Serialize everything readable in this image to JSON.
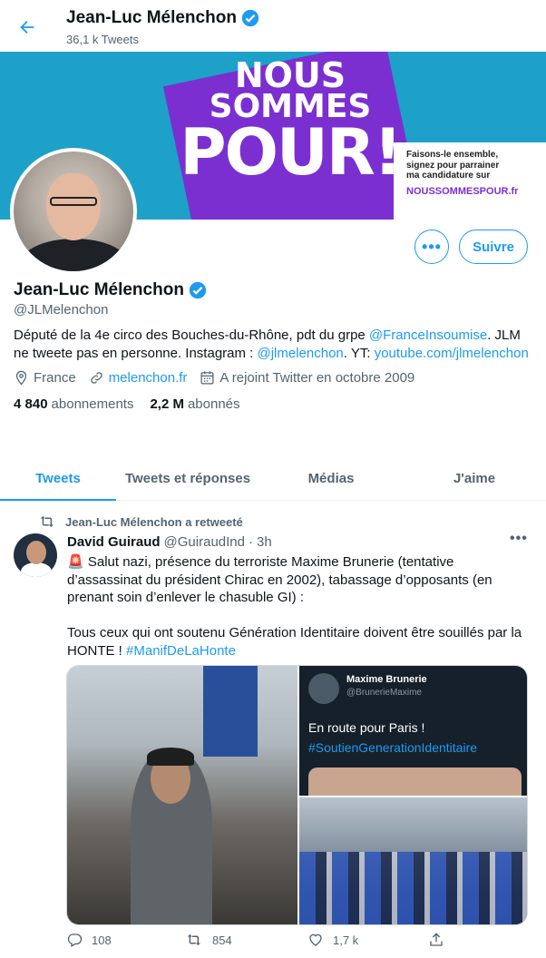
{
  "header": {
    "name": "Jean-Luc Mélenchon",
    "tweet_count": "36,1 k Tweets"
  },
  "banner": {
    "line1": "NOUS",
    "line2": "SOMMES",
    "line3": "POUR!",
    "card_text1": "Faisons-le ensemble,",
    "card_text2": "signez pour parrainer",
    "card_text3": "ma candidature sur",
    "card_site": "NOUSSOMMESPOUR.fr"
  },
  "profile": {
    "name": "Jean-Luc Mélenchon",
    "handle": "@JLMelenchon",
    "follow_label": "Suivre",
    "more_label": "•••",
    "bio_part1": "Député de la 4e circo des Bouches-du-Rhône, pdt du grpe ",
    "bio_link1": "@FranceInsoumise",
    "bio_part2": ". JLM ne tweete pas en personne. Instagram : ",
    "bio_link2": "@jlmelenchon",
    "bio_part3": ". YT: ",
    "bio_link3": "youtube.com/jlmelenchon",
    "location": "France",
    "website": "melenchon.fr",
    "joined": "A rejoint Twitter en octobre 2009",
    "following_count": "4 840",
    "following_label": "abonnements",
    "followers_count": "2,2 M",
    "followers_label": "abonnés"
  },
  "tabs": [
    {
      "label": "Tweets",
      "active": true
    },
    {
      "label": "Tweets et réponses",
      "active": false
    },
    {
      "label": "Médias",
      "active": false
    },
    {
      "label": "J'aime",
      "active": false
    }
  ],
  "tweet": {
    "retweeted_by": "Jean-Luc Mélenchon a retweeté",
    "author_name": "David Guiraud",
    "author_handle": "@GuiraudInd",
    "separator": "·",
    "time": "3h",
    "text": "🚨 Salut nazi, présence du terroriste Maxime Brunerie (tentative d’assassinat du président Chirac en 2002), tabassage d’opposants (en prenant soin d’enlever le chasuble GI) :\n\nTous ceux qui ont soutenu Génération Identitaire doivent être souillés par la HONTE ! ",
    "hashtag": "#ManifDeLaHonte",
    "embedded": {
      "name": "Maxime Brunerie",
      "handle": "@BrunerieMaxime",
      "line1": "En route pour Paris !",
      "line2": "#SoutienGenerationIdentitaire"
    },
    "replies": "108",
    "retweets": "854",
    "likes": "1,7 k"
  },
  "colors": {
    "accent": "#1d9bf0",
    "banner_bg": "#1da1c8",
    "banner_shape": "#7b2fd1"
  }
}
